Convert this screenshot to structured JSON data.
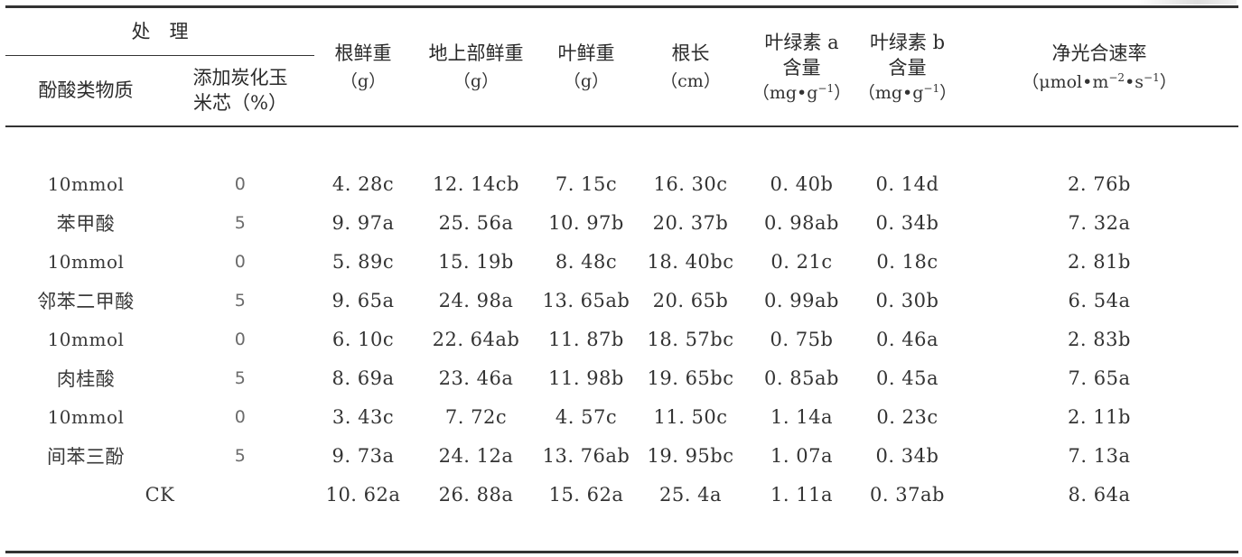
{
  "header": {
    "treatment": "处　理",
    "phenolic": "酚酸类物质",
    "biochar_line1": "添加炭化玉",
    "biochar_line2": "米芯（%）",
    "columns": [
      {
        "label": "根鲜重",
        "unit": "（g）"
      },
      {
        "label": "地上部鲜重",
        "unit": "（g）"
      },
      {
        "label": "叶鲜重",
        "unit": "（g）"
      },
      {
        "label": "根长",
        "unit": "（cm）"
      },
      {
        "label_line1": "叶绿素 a",
        "label_line2": "含量",
        "unit_base": "（mg•g",
        "unit_exp": "−1",
        "unit_end": "）"
      },
      {
        "label_line1": "叶绿素 b",
        "label_line2": "含量",
        "unit_base": "（mg•g",
        "unit_exp": "−1",
        "unit_end": "）"
      },
      {
        "label": "净光合速率",
        "unit_a": "（μmol•m",
        "unit_exp1": "−2",
        "unit_b": "•s",
        "unit_exp2": "−1",
        "unit_end": "）"
      }
    ]
  },
  "groups": [
    {
      "conc": "10mmol",
      "name": "苯甲酸",
      "rows": [
        {
          "add": "0",
          "values": [
            "4. 28c",
            "12. 14cb",
            "7. 15c",
            "16. 30c",
            "0. 40b",
            "0. 14d",
            "2. 76b"
          ]
        },
        {
          "add": "5",
          "values": [
            "9. 97a",
            "25. 56a",
            "10. 97b",
            "20. 37b",
            "0. 98ab",
            "0. 34b",
            "7. 32a"
          ]
        }
      ]
    },
    {
      "conc": "10mmol",
      "name": "邻苯二甲酸",
      "rows": [
        {
          "add": "0",
          "values": [
            "5. 89c",
            "15. 19b",
            "8. 48c",
            "18. 40bc",
            "0. 21c",
            "0. 18c",
            "2. 81b"
          ]
        },
        {
          "add": "5",
          "values": [
            "9. 65a",
            "24. 98a",
            "13. 65ab",
            "20. 65b",
            "0. 99ab",
            "0. 30b",
            "6. 54a"
          ]
        }
      ]
    },
    {
      "conc": "10mmol",
      "name": "肉桂酸",
      "rows": [
        {
          "add": "0",
          "values": [
            "6. 10c",
            "22. 64ab",
            "11. 87b",
            "18. 57bc",
            "0. 75b",
            "0. 46a",
            "2. 83b"
          ]
        },
        {
          "add": "5",
          "values": [
            "8. 69a",
            "23. 46a",
            "11. 98b",
            "19. 65bc",
            "0. 85ab",
            "0. 45a",
            "7. 65a"
          ]
        }
      ]
    },
    {
      "conc": "10mmol",
      "name": "间苯三酚",
      "rows": [
        {
          "add": "0",
          "values": [
            "3. 43c",
            "7. 72c",
            "4. 57c",
            "11. 50c",
            "1. 14a",
            "0. 23c",
            "2. 11b"
          ]
        },
        {
          "add": "5",
          "values": [
            "9. 73a",
            "24. 12a",
            "13. 76ab",
            "19. 95bc",
            "1. 07a",
            "0. 34b",
            "7. 13a"
          ]
        }
      ]
    }
  ],
  "control": {
    "label": "CK",
    "values": [
      "10. 62a",
      "26. 88a",
      "15. 62a",
      "25. 4a",
      "1. 11a",
      "0. 37ab",
      "8. 64a"
    ]
  }
}
